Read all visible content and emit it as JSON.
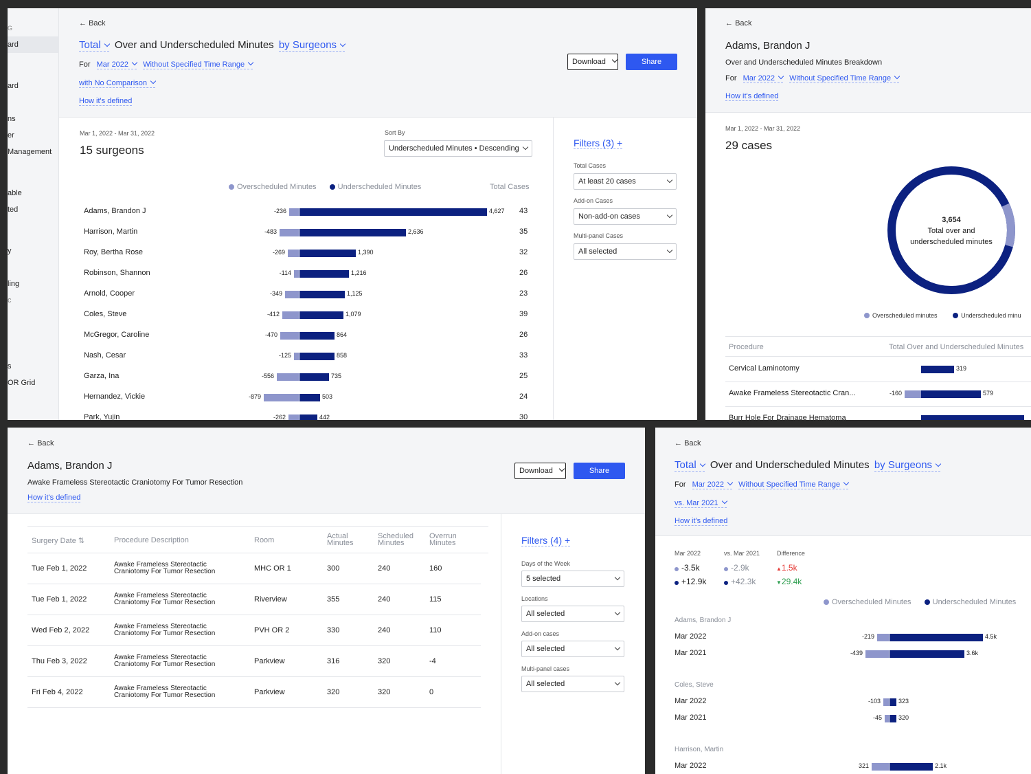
{
  "colors": {
    "navy": "#0c2180",
    "lavender": "#8e96cc",
    "link": "#2e58f0",
    "up": "#e53935",
    "down": "#2e9e4f"
  },
  "icons": {
    "back": "arrow-left-icon",
    "plus": "plus-icon",
    "chevron": "chevron-down-icon",
    "sort": "sort-icon"
  },
  "sidebar": {
    "items": [
      "G",
      "ard",
      "ard",
      "ns",
      "er",
      "Management",
      "able",
      "ted",
      "y",
      "ling",
      "c",
      "s",
      "OR Grid"
    ]
  },
  "p1": {
    "back": "Back",
    "title": {
      "total": "Total",
      "main": "Over and Underscheduled Minutes",
      "by": "by Surgeons"
    },
    "for_label": "For",
    "month": "Mar 2022",
    "range": "Without Specified Time Range",
    "comparison": "with No Comparison",
    "defined": "How it's defined",
    "download": "Download",
    "share": "Share",
    "date_range": "Mar 1, 2022 - Mar 31, 2022",
    "count": "15 surgeons",
    "sort_label": "Sort By",
    "sort_value": "Underscheduled Minutes • Descending",
    "legend_over": "Overscheduled Minutes",
    "legend_under": "Underscheduled Minutes",
    "total_cases": "Total Cases",
    "filters": "Filters (3)",
    "f1_label": "Total Cases",
    "f1_value": "At least 20 cases",
    "f2_label": "Add-on Cases",
    "f2_value": "Non-add-on cases",
    "f3_label": "Multi-panel Cases",
    "f3_value": "All selected",
    "rows": [
      {
        "name": "Adams, Brandon J",
        "over": "-236",
        "under": "4,627",
        "cases": "43",
        "o": 236,
        "u": 4627
      },
      {
        "name": "Harrison, Martin",
        "over": "-483",
        "under": "2,636",
        "cases": "35",
        "o": 483,
        "u": 2636
      },
      {
        "name": "Roy, Bertha Rose",
        "over": "-269",
        "under": "1,390",
        "cases": "32",
        "o": 269,
        "u": 1390
      },
      {
        "name": "Robinson, Shannon",
        "over": "-114",
        "under": "1,216",
        "cases": "26",
        "o": 114,
        "u": 1216
      },
      {
        "name": "Arnold, Cooper",
        "over": "-349",
        "under": "1,125",
        "cases": "23",
        "o": 349,
        "u": 1125
      },
      {
        "name": "Coles, Steve",
        "over": "-412",
        "under": "1,079",
        "cases": "39",
        "o": 412,
        "u": 1079
      },
      {
        "name": "McGregor, Caroline",
        "over": "-470",
        "under": "864",
        "cases": "26",
        "o": 470,
        "u": 864
      },
      {
        "name": "Nash, Cesar",
        "over": "-125",
        "under": "858",
        "cases": "33",
        "o": 125,
        "u": 858
      },
      {
        "name": "Garza, Ina",
        "over": "-556",
        "under": "735",
        "cases": "25",
        "o": 556,
        "u": 735
      },
      {
        "name": "Hernandez, Vickie",
        "over": "-879",
        "under": "503",
        "cases": "24",
        "o": 879,
        "u": 503
      },
      {
        "name": "Park, Yujin",
        "over": "-262",
        "under": "442",
        "cases": "30",
        "o": 262,
        "u": 442
      }
    ]
  },
  "p2": {
    "back": "Back",
    "name": "Adams, Brandon J",
    "subtitle": "Over and Underscheduled Minutes Breakdown",
    "for_label": "For",
    "month": "Mar 2022",
    "range": "Without Specified Time Range",
    "defined": "How it's defined",
    "date_range": "Mar 1, 2022 - Mar 31, 2022",
    "count": "29 cases",
    "center_value": "3,654",
    "center_l1": "Total over and",
    "center_l2": "underscheduled minutes",
    "donut": {
      "over": 236,
      "under": 4627
    },
    "legend_over": "Overscheduled minutes",
    "legend_under": "Underscheduled minu",
    "col1": "Procedure",
    "col2": "Total Over and Underscheduled Minutes",
    "rows": [
      {
        "name": "Cervical Laminotomy",
        "over": "",
        "under": "319",
        "o": 0,
        "u": 319
      },
      {
        "name": "Awake Frameless Stereotactic Cran...",
        "over": "-160",
        "under": "579",
        "o": 160,
        "u": 579
      },
      {
        "name": "Burr Hole For Drainage Hematoma",
        "over": "",
        "under": "",
        "o": 0,
        "u": 1000
      }
    ]
  },
  "p3": {
    "back": "Back",
    "name": "Adams, Brandon J",
    "subtitle": "Awake Frameless Stereotactic Craniotomy For Tumor Resection",
    "defined": "How it's defined",
    "download": "Download",
    "share": "Share",
    "headers": [
      "Surgery Date",
      "Procedure Description",
      "Room",
      "Actual Minutes",
      "Scheduled Minutes",
      "Overrun Minutes"
    ],
    "rows": [
      {
        "date": "Tue Feb 1, 2022",
        "p1": "Awake Frameless Stereotactic",
        "p2": "Craniotomy For Tumor Resection",
        "room": "MHC OR 1",
        "actual": "300",
        "sched": "240",
        "over": "160"
      },
      {
        "date": "Tue Feb 1, 2022",
        "p1": "Awake Frameless Stereotactic",
        "p2": "Craniotomy For Tumor Resection",
        "room": "Riverview",
        "actual": "355",
        "sched": "240",
        "over": "115"
      },
      {
        "date": "Wed Feb 2, 2022",
        "p1": "Awake Frameless Stereotactic",
        "p2": "Craniotomy For Tumor Resection",
        "room": "PVH OR 2",
        "actual": "330",
        "sched": "240",
        "over": "110"
      },
      {
        "date": "Thu Feb 3, 2022",
        "p1": "Awake Frameless Stereotactic",
        "p2": "Craniotomy For Tumor Resection",
        "room": "Parkview",
        "actual": "316",
        "sched": "320",
        "over": "-4"
      },
      {
        "date": "Fri Feb 4, 2022",
        "p1": "Awake Frameless Stereotactic",
        "p2": "Craniotomy For Tumor Resection",
        "room": "Parkview",
        "actual": "320",
        "sched": "320",
        "over": "0"
      }
    ],
    "filters": "Filters (4)",
    "f1_label": "Days of the Week",
    "f1_value": "5 selected",
    "f2_label": "Locations",
    "f2_value": "All selected",
    "f3_label": "Add-on cases",
    "f3_value": "All selected",
    "f4_label": "Multi-panel cases",
    "f4_value": "All selected"
  },
  "p4": {
    "back": "Back",
    "title": {
      "total": "Total",
      "main": "Over and Underscheduled Minutes",
      "by": "by Surgeons"
    },
    "for_label": "For",
    "month": "Mar 2022",
    "range": "Without Specified Time Range",
    "comparison": "vs. Mar 2021",
    "defined": "How it's defined",
    "h_cur": "Mar 2022",
    "h_prev": "vs. Mar 2021",
    "h_diff": "Difference",
    "cur_over": "-3.5k",
    "cur_under": "+12.9k",
    "prev_over": "-2.9k",
    "prev_under": "+42.3k",
    "diff_over": "1.5k",
    "diff_under": "29.4k",
    "legend_over": "Overscheduled Minutes",
    "legend_under": "Underscheduled Minutes",
    "groups": [
      {
        "name": "Adams, Brandon J",
        "rows": [
          {
            "period": "Mar 2022",
            "over": "-219",
            "under": "4.5k",
            "o": 219,
            "u": 4500
          },
          {
            "period": "Mar 2021",
            "over": "-439",
            "under": "3.6k",
            "o": 439,
            "u": 3600
          }
        ]
      },
      {
        "name": "Coles, Steve",
        "rows": [
          {
            "period": "Mar 2022",
            "over": "-103",
            "under": "323",
            "o": 103,
            "u": 323
          },
          {
            "period": "Mar 2021",
            "over": "-45",
            "under": "320",
            "o": 45,
            "u": 320
          }
        ]
      },
      {
        "name": "Harrison, Martin",
        "rows": [
          {
            "period": "Mar 2022",
            "over": "321",
            "under": "2.1k",
            "o": 321,
            "u": 2100
          }
        ]
      }
    ]
  }
}
